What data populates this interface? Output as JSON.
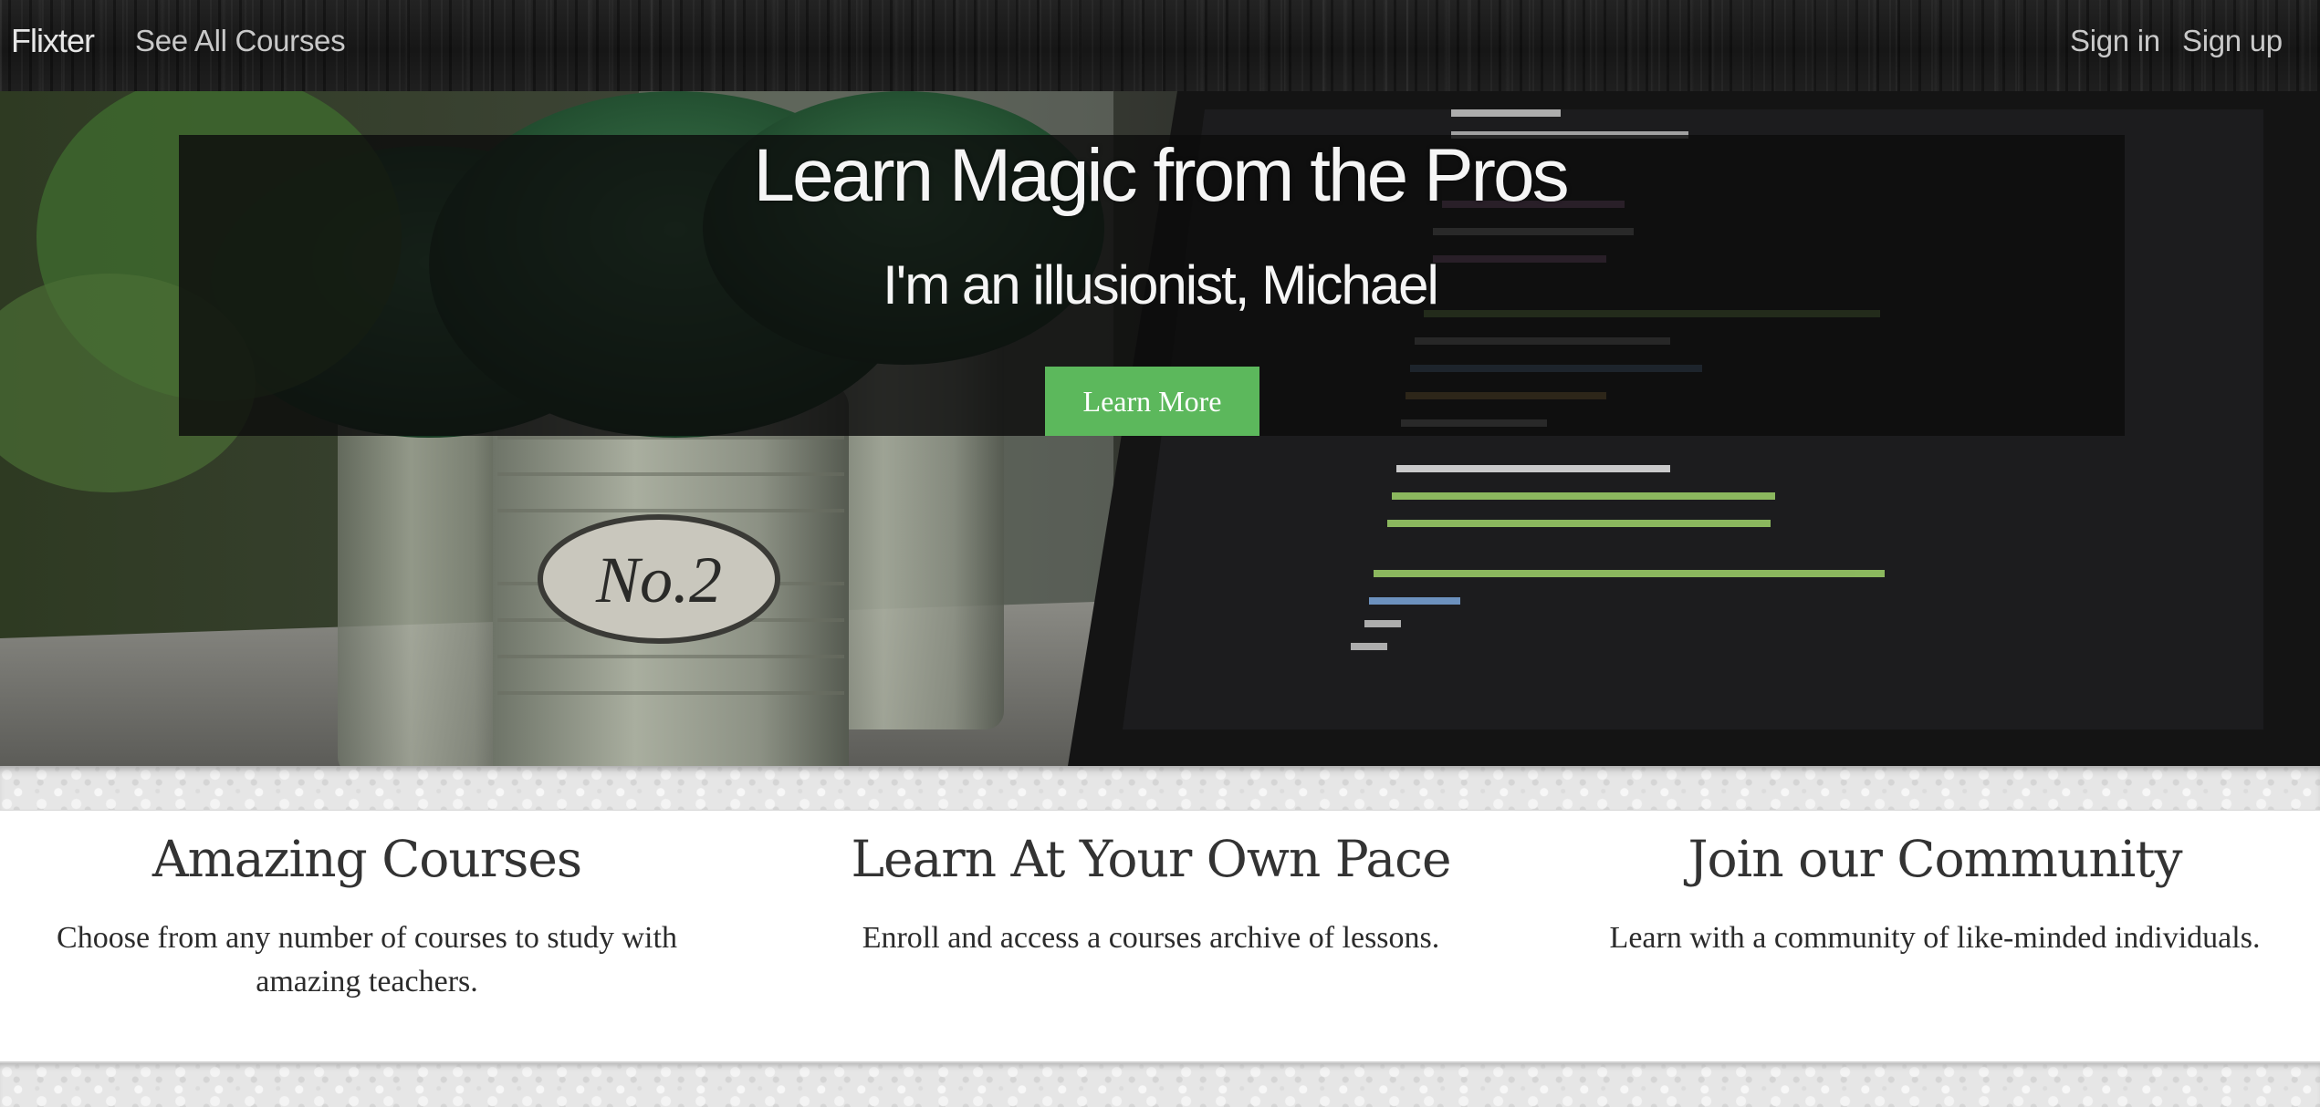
{
  "navbar": {
    "brand": "Flixter",
    "see_all_courses": "See All Courses",
    "sign_in": "Sign in",
    "sign_up": "Sign up"
  },
  "hero": {
    "title": "Learn Magic from the Pros",
    "subtitle": "I'm an illusionist, Michael",
    "button_label": "Learn More",
    "button_color": "#5cb85c",
    "background_image": "potted succulents beside a laptop showing code"
  },
  "features": [
    {
      "title": "Amazing Courses",
      "text": "Choose from any number of courses to study with amazing teachers."
    },
    {
      "title": "Learn At Your Own Pace",
      "text": "Enroll and access a courses archive of lessons."
    },
    {
      "title": "Join our Community",
      "text": "Learn with a community of like-minded individuals."
    }
  ]
}
